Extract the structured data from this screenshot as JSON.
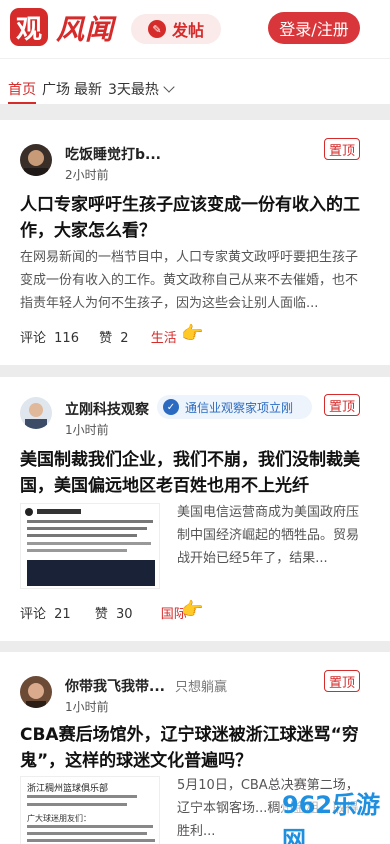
{
  "header": {
    "logo_glyph": "观",
    "logo_text": "风闻",
    "post_label": "发帖",
    "login_label": "登录/注册"
  },
  "tabs": [
    "首页",
    "广场",
    "最新",
    "3天最热"
  ],
  "posts": [
    {
      "author": "吃饭睡觉打b...",
      "time": "2小时前",
      "pin": "置顶",
      "title": "人口专家呼吁生孩子应该变成一份有收入的工作，大家怎么看？",
      "summary": "在网易新闻的一档节目中，人口专家黄文政呼吁要把生孩子变成一份有收入的工作。黄文政称自己从来不去催婚，也不指责年轻人为何不生孩子，因为这些会让别人面临...",
      "comments_label": "评论",
      "comments": "116",
      "likes_label": "赞",
      "likes": "2",
      "tag": "生活"
    },
    {
      "author": "立刚科技观察",
      "cert": "通信业观察家项立刚",
      "time": "1小时前",
      "pin": "置顶",
      "title": "美国制裁我们企业，我们不崩，我们没制裁美国，美国偏远地区老百姓也用不上光纤",
      "summary": "美国电信运营商成为美国政府压制中国经济崛起的牺牲品。贸易战开始已经5年了，结果...",
      "comments_label": "评论",
      "comments": "21",
      "likes_label": "赞",
      "likes": "30",
      "tag": "国际"
    },
    {
      "author": "你带我飞我带...",
      "note": "只想躺赢",
      "time": "1小时前",
      "pin": "置顶",
      "title": "CBA赛后场馆外，辽宁球迷被浙江球迷骂“穷鬼”，这样的球迷文化普遍吗？",
      "summary": "5月10日，CBA总决赛第二场，辽宁本钢客场...稠州金租，取得胜利...",
      "thumb_heading": "浙江稠州篮球俱乐部",
      "thumb_line": "广大球迷朋友们："
    }
  ],
  "watermark": "962乐游网"
}
